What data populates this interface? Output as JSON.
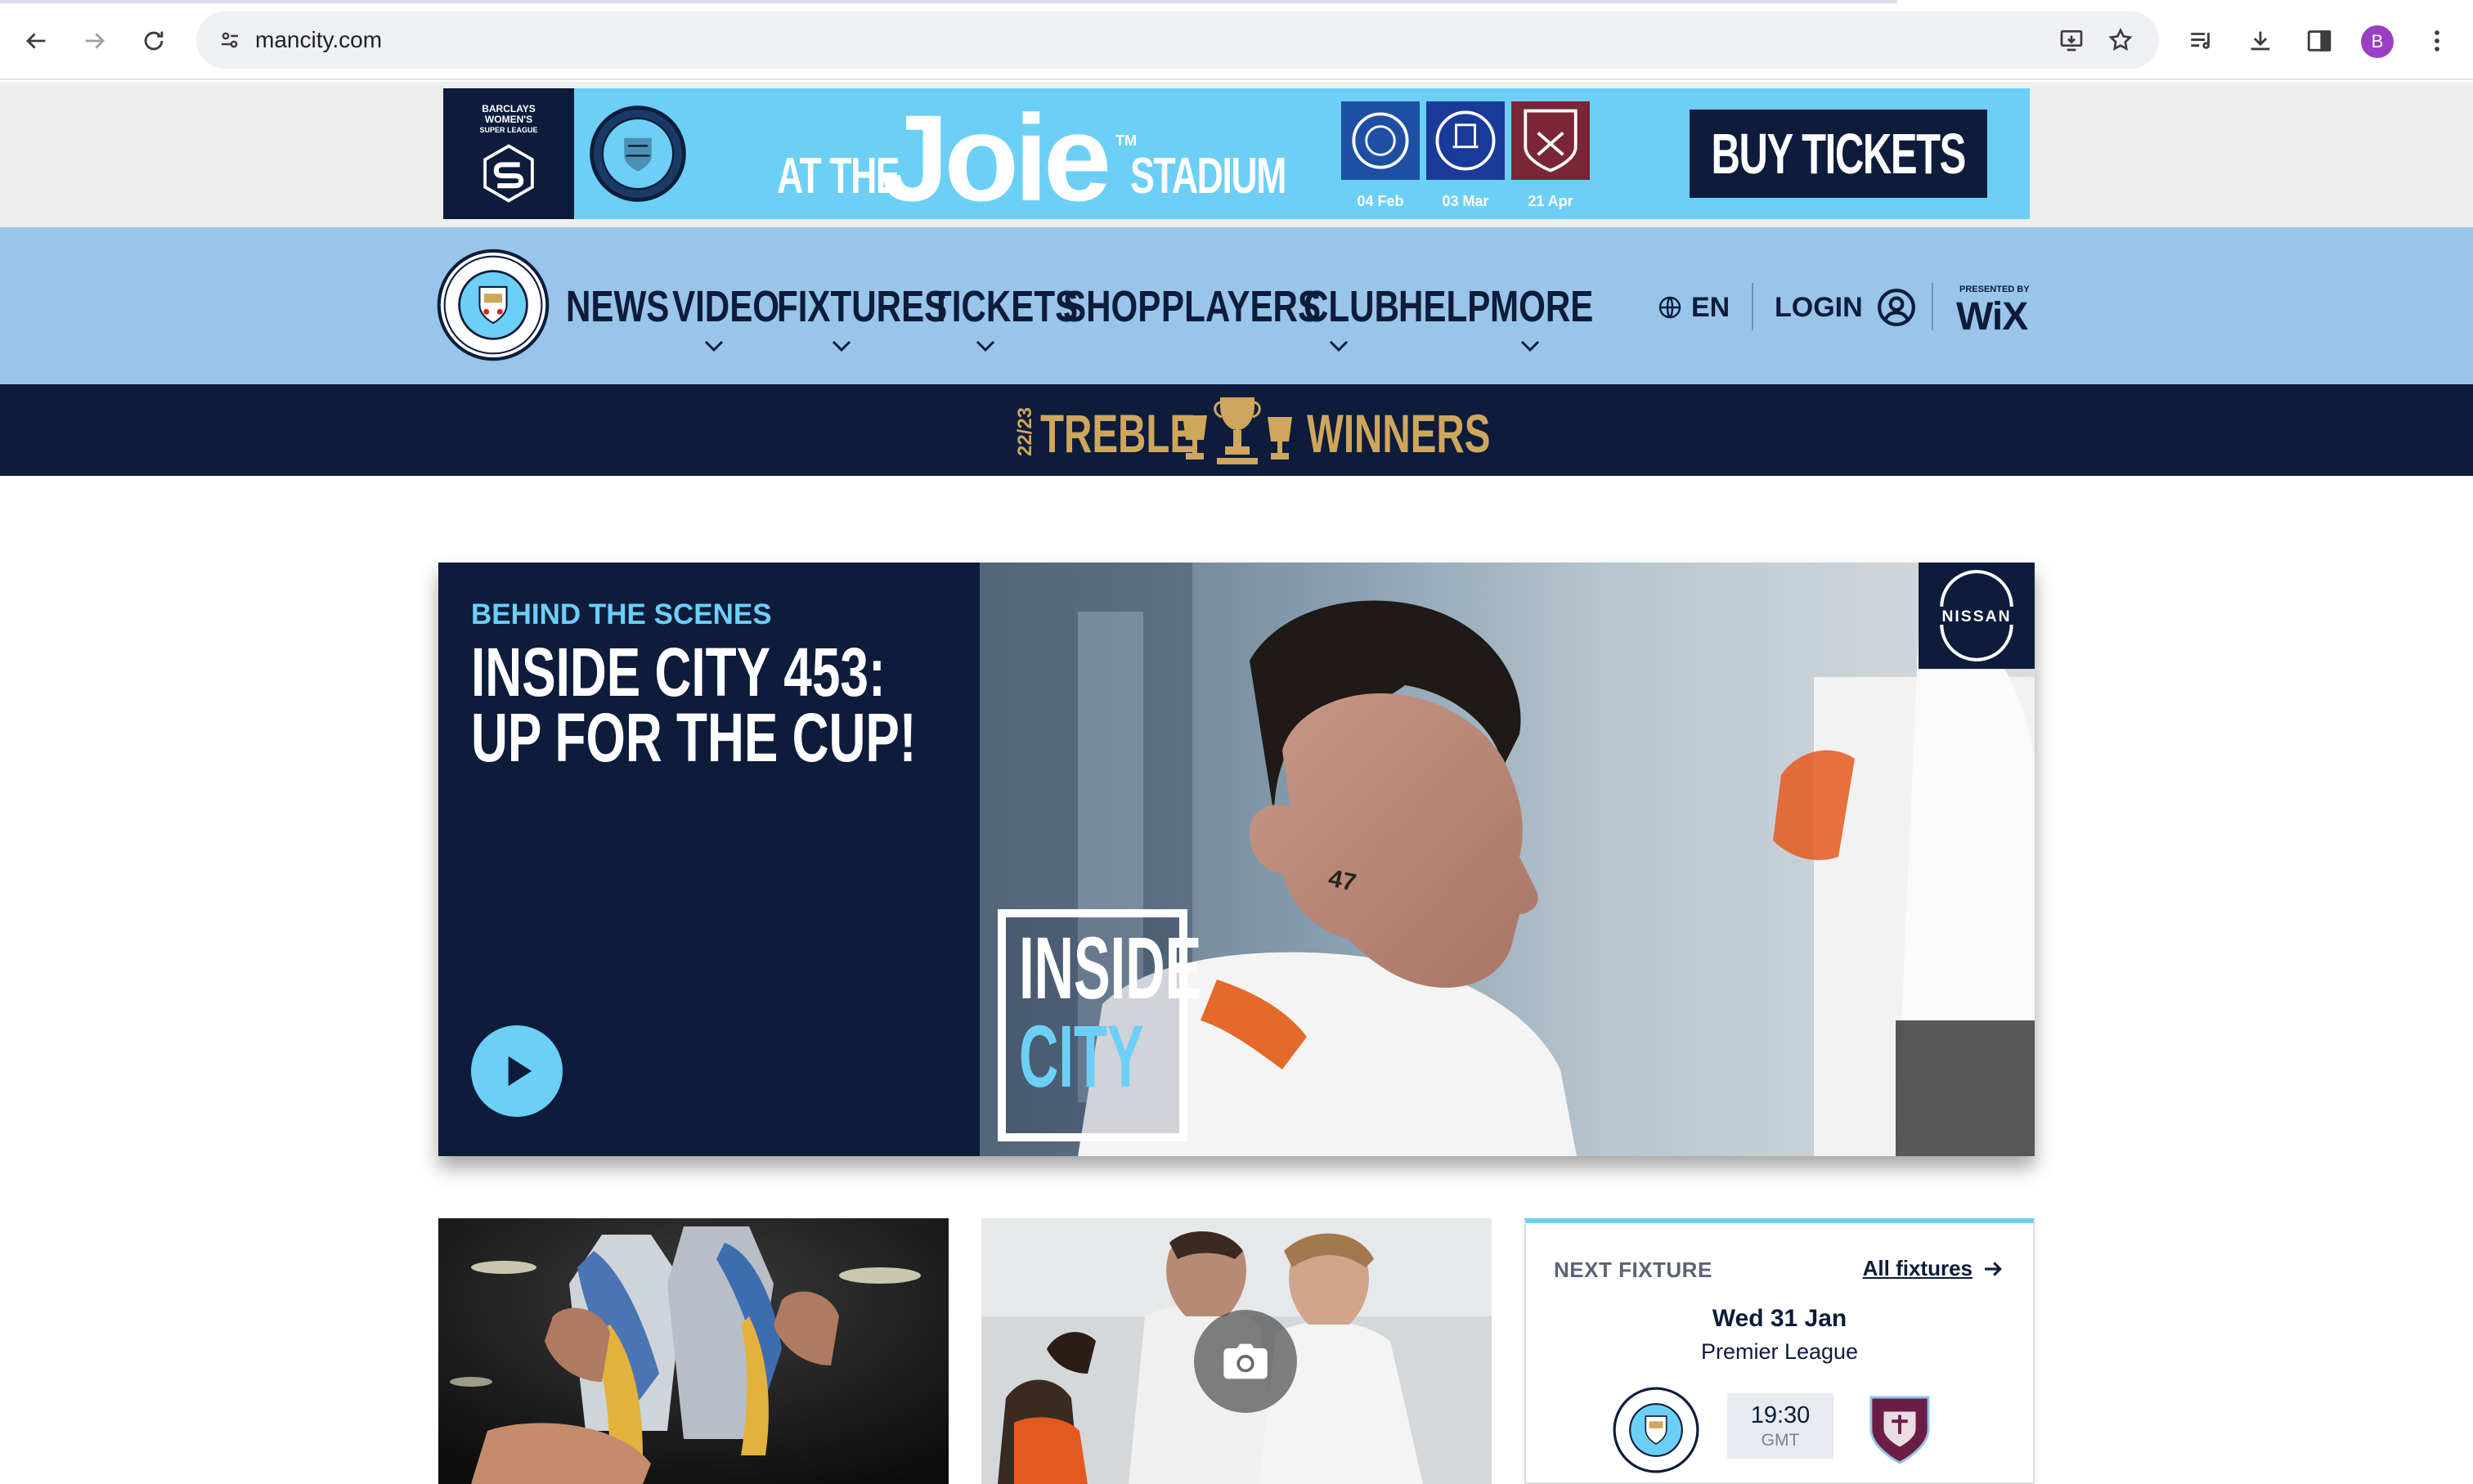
{
  "browser": {
    "url": "mancity.com",
    "profile_initial": "B"
  },
  "ad": {
    "wsl_lines": [
      "BARCLAYS",
      "WOMEN'S",
      "SUPER LEAGUE"
    ],
    "at_the": "AT THE",
    "brand": "Joie",
    "tm": "TM",
    "stadium": "STADIUM",
    "fixtures": [
      {
        "date": "04 Feb",
        "color": "#1f4fa3"
      },
      {
        "date": "03 Mar",
        "color": "#1a3a9a"
      },
      {
        "date": "21 Apr",
        "color": "#7a2635"
      }
    ],
    "cta": "BUY TICKETS"
  },
  "nav": {
    "items": [
      {
        "label": "NEWS",
        "dropdown": false
      },
      {
        "label": "VIDEO",
        "dropdown": true
      },
      {
        "label": "FIXTURES",
        "dropdown": true
      },
      {
        "label": "TICKETS",
        "dropdown": true
      },
      {
        "label": "SHOP",
        "dropdown": false
      },
      {
        "label": "PLAYERS",
        "dropdown": false
      },
      {
        "label": "CLUB",
        "dropdown": true
      },
      {
        "label": "HELP",
        "dropdown": false
      },
      {
        "label": "MORE",
        "dropdown": true
      }
    ],
    "language": "EN",
    "login": "LOGIN",
    "sponsor_pre": "PRESENTED BY",
    "sponsor": "WiX"
  },
  "treble": {
    "season": "22/23",
    "word1": "TREBLE",
    "word2": "WINNERS"
  },
  "hero": {
    "kicker": "BEHIND THE SCENES",
    "title": "INSIDE CITY 453: UP FOR THE CUP!",
    "badge_line1": "INSIDE",
    "badge_line2": "CITY",
    "sponsor": "NISSAN",
    "shirt_number": "47"
  },
  "next_fixture": {
    "label": "NEXT FIXTURE",
    "all_link": "All fixtures",
    "date": "Wed 31 Jan",
    "competition": "Premier League",
    "time": "19:30",
    "timezone": "GMT"
  },
  "colors": {
    "navy": "#0d1c3b",
    "sky": "#6ccff6",
    "nav_bg": "#98c5e9",
    "gold": "#cfa65c"
  }
}
